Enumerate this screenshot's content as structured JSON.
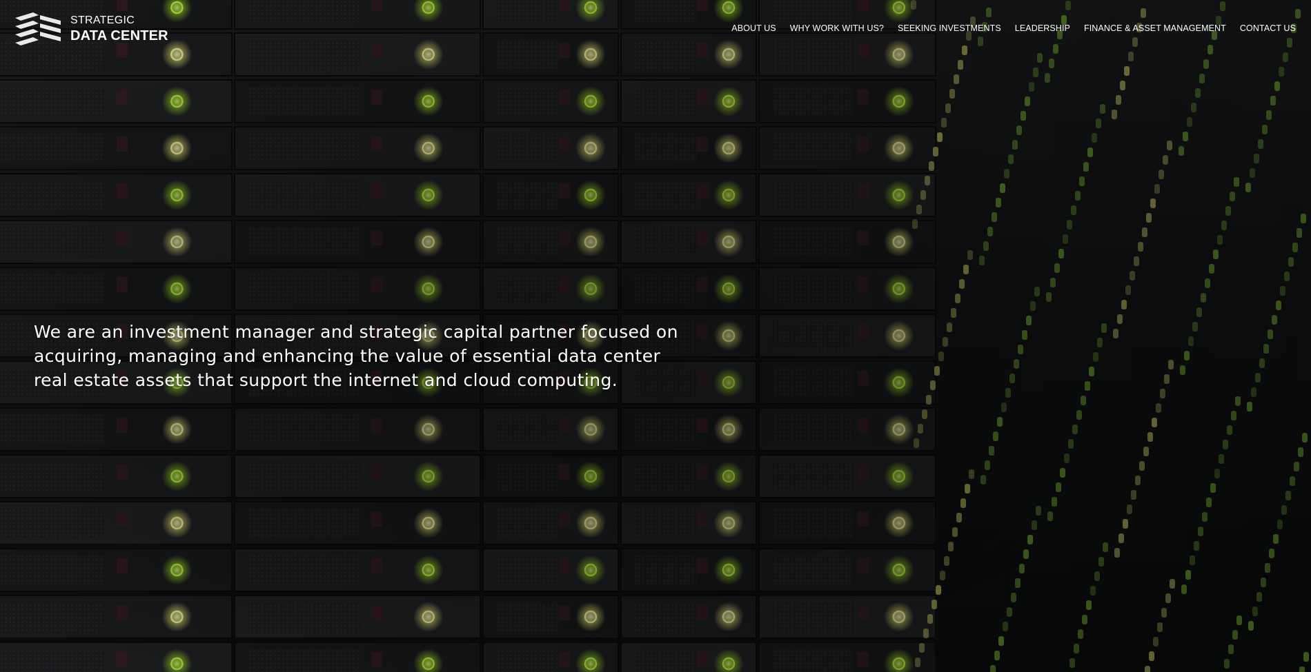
{
  "brand": {
    "line1": "STRATEGIC",
    "line2": "DATA CENTER"
  },
  "nav": {
    "items": [
      {
        "label": "ABOUT US"
      },
      {
        "label": "WHY WORK WITH US?"
      },
      {
        "label": "SEEKING INVESTMENTS"
      },
      {
        "label": "LEADERSHIP"
      },
      {
        "label": "FINANCE & ASSET MANAGEMENT"
      },
      {
        "label": "CONTACT US"
      }
    ]
  },
  "hero": {
    "headline": "We are an investment manager and strategic capital partner focused on acquiring, managing and enhancing the value of essential data center real estate assets that support the internet and cloud computing."
  },
  "colors": {
    "text": "#ffffff",
    "led_green": "#9bd62a",
    "led_yellow": "#e4e37a",
    "background": "#151618"
  },
  "icons": {
    "logo": "stacked-chevron-logo-icon",
    "background": "server-rack-photo"
  }
}
